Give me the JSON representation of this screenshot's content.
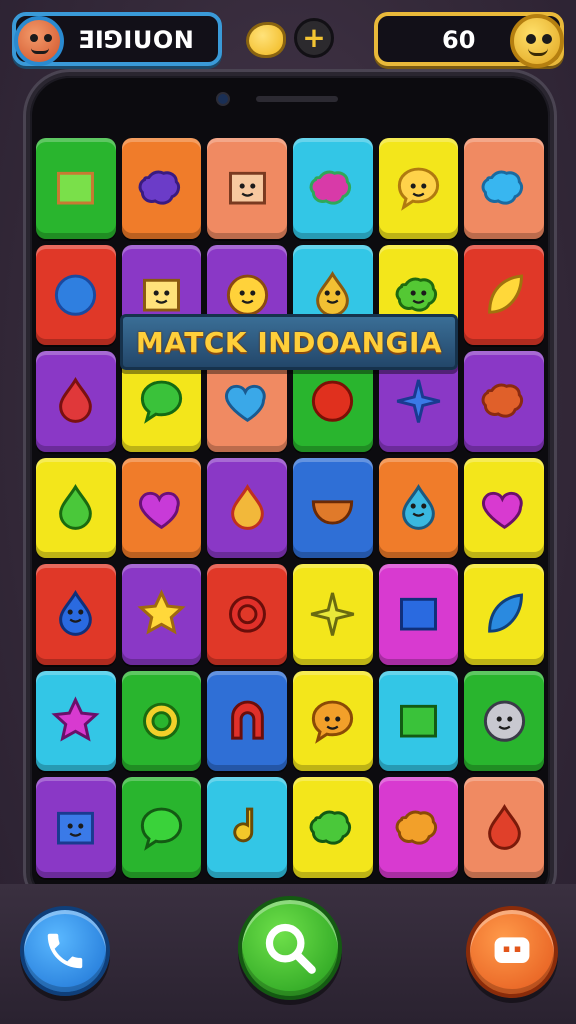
{
  "hud": {
    "player_name": "ƎIꓨIUON",
    "score": "60",
    "powerup_plus": "+"
  },
  "banner": {
    "title": "MATCK INDOANGIA"
  },
  "colors": {
    "green": "#29b52e",
    "orange": "#f07c2a",
    "salmon": "#f08a62",
    "cyan": "#33c6e6",
    "yellow": "#f3e61b",
    "red": "#e03828",
    "purple": "#8a38c6",
    "magenta": "#d83ad0",
    "blue": "#2f6fd6"
  },
  "board": {
    "rows": [
      [
        {
          "color": "green",
          "icon": "cactus-pot-icon"
        },
        {
          "color": "orange",
          "icon": "purple-blob-icon"
        },
        {
          "color": "salmon",
          "icon": "smiley-face-icon"
        },
        {
          "color": "cyan",
          "icon": "splat-icon"
        },
        {
          "color": "yellow",
          "icon": "speech-bubble-icon"
        },
        {
          "color": "salmon",
          "icon": "blue-splat-icon"
        }
      ],
      [
        {
          "color": "red",
          "icon": "blue-orb-icon"
        },
        {
          "color": "purple",
          "icon": "yellow-monster-icon"
        },
        {
          "color": "purple",
          "icon": "grinning-face-icon"
        },
        {
          "color": "cyan",
          "icon": "yellow-creature-icon"
        },
        {
          "color": "yellow",
          "icon": "green-frog-icon"
        },
        {
          "color": "red",
          "icon": "yellow-leaf-icon"
        }
      ],
      [
        {
          "color": "purple",
          "icon": "red-balloon-icon"
        },
        {
          "color": "yellow",
          "icon": "green-bubble-icon"
        },
        {
          "color": "salmon",
          "icon": "blue-heart-icon"
        },
        {
          "color": "green",
          "icon": "apple-icon"
        },
        {
          "color": "purple",
          "icon": "blue-star-icon"
        },
        {
          "color": "purple",
          "icon": "rose-icon"
        }
      ],
      [
        {
          "color": "yellow",
          "icon": "green-drop-icon"
        },
        {
          "color": "orange",
          "icon": "purple-fruit-icon"
        },
        {
          "color": "purple",
          "icon": "pizza-slice-icon"
        },
        {
          "color": "blue",
          "icon": "bowl-icon"
        },
        {
          "color": "orange",
          "icon": "blue-face-icon"
        },
        {
          "color": "yellow",
          "icon": "magenta-apple-icon"
        }
      ],
      [
        {
          "color": "red",
          "icon": "blue-face-drop-icon"
        },
        {
          "color": "purple",
          "icon": "yellow-star-icon"
        },
        {
          "color": "red",
          "icon": "red-ring-icon"
        },
        {
          "color": "yellow",
          "icon": "yellow-sparkle-icon"
        },
        {
          "color": "magenta",
          "icon": "blue-jar-icon"
        },
        {
          "color": "yellow",
          "icon": "blue-leaf-icon"
        }
      ],
      [
        {
          "color": "cyan",
          "icon": "magenta-star-icon"
        },
        {
          "color": "green",
          "icon": "green-ring-icon"
        },
        {
          "color": "blue",
          "icon": "red-arch-icon"
        },
        {
          "color": "yellow",
          "icon": "orange-ghost-icon"
        },
        {
          "color": "cyan",
          "icon": "green-box-icon"
        },
        {
          "color": "green",
          "icon": "bear-face-icon"
        }
      ],
      [
        {
          "color": "purple",
          "icon": "blue-cube-face-icon"
        },
        {
          "color": "green",
          "icon": "green-chat-icon"
        },
        {
          "color": "cyan",
          "icon": "music-note-icon"
        },
        {
          "color": "yellow",
          "icon": "green-blob-icon"
        },
        {
          "color": "magenta",
          "icon": "orange-blob-icon"
        },
        {
          "color": "salmon",
          "icon": "red-pear-icon"
        }
      ]
    ]
  },
  "buttons": {
    "call": "phone-icon",
    "search": "search-icon",
    "chat": "chat-icon"
  }
}
